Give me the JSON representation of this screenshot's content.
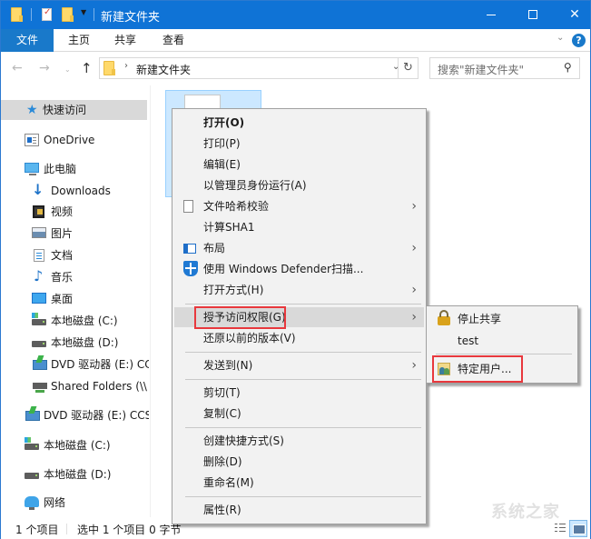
{
  "window": {
    "title": "新建文件夹",
    "controls": {
      "minimize": "minimize",
      "maximize": "maximize",
      "close": "✕"
    }
  },
  "ribbon": {
    "tabs": [
      {
        "label": "文件",
        "active": true
      },
      {
        "label": "主页"
      },
      {
        "label": "共享"
      },
      {
        "label": "查看"
      }
    ],
    "expand_glyph": "⌄",
    "help_glyph": "?"
  },
  "navigation": {
    "back_glyph": "←",
    "forward_glyph": "→",
    "recent_glyph": "⌄",
    "up_glyph": "↑",
    "address_chevron": "›",
    "address_path": "新建文件夹",
    "address_dropdown": "⌄",
    "refresh_glyph": "↻",
    "search_placeholder": "搜索\"新建文件夹\"",
    "search_glyph": "⚲"
  },
  "sidebar": {
    "items": [
      {
        "label": "快速访问",
        "icon": "star-icon",
        "selected": true
      },
      {
        "label": "OneDrive",
        "icon": "onedrive-icon"
      },
      {
        "label": "此电脑",
        "icon": "this-pc-icon"
      },
      {
        "label": "Downloads",
        "icon": "downloads-icon"
      },
      {
        "label": "视频",
        "icon": "videos-icon"
      },
      {
        "label": "图片",
        "icon": "pictures-icon"
      },
      {
        "label": "文档",
        "icon": "documents-icon"
      },
      {
        "label": "音乐",
        "icon": "music-icon"
      },
      {
        "label": "桌面",
        "icon": "desktop-icon"
      },
      {
        "label": "本地磁盘 (C:)",
        "icon": "drive-c-icon"
      },
      {
        "label": "本地磁盘 (D:)",
        "icon": "drive-icon"
      },
      {
        "label": "DVD 驱动器 (E:) CC",
        "icon": "dvd-drive-icon"
      },
      {
        "label": "Shared Folders (\\\\",
        "icon": "network-drive-icon"
      },
      {
        "label": "DVD 驱动器 (E:) CCS",
        "icon": "dvd-drive-icon"
      },
      {
        "label": "本地磁盘 (C:)",
        "icon": "drive-c-icon"
      },
      {
        "label": "本地磁盘 (D:)",
        "icon": "drive-icon"
      },
      {
        "label": "网络",
        "icon": "network-icon"
      }
    ]
  },
  "context_menu": {
    "items": [
      {
        "label": "打开(O)",
        "bold": true
      },
      {
        "label": "打印(P)"
      },
      {
        "label": "编辑(E)"
      },
      {
        "label": "以管理员身份运行(A)"
      },
      {
        "label": "文件哈希校验",
        "icon": "page-icon",
        "submenu": true
      },
      {
        "label": "计算SHA1"
      },
      {
        "label": "布局",
        "icon": "layout-icon",
        "submenu": true
      },
      {
        "label": "使用 Windows Defender扫描...",
        "icon": "defender-shield-icon"
      },
      {
        "label": "打开方式(H)",
        "submenu": true
      },
      {
        "label": "授予访问权限(G)",
        "submenu": true,
        "highlighted": true
      },
      {
        "label": "还原以前的版本(V)"
      },
      {
        "label": "发送到(N)",
        "submenu": true
      },
      {
        "label": "剪切(T)"
      },
      {
        "label": "复制(C)"
      },
      {
        "label": "创建快捷方式(S)"
      },
      {
        "label": "删除(D)"
      },
      {
        "label": "重命名(M)"
      },
      {
        "label": "属性(R)"
      }
    ],
    "submenu_arrow": "›"
  },
  "share_submenu": {
    "items": [
      {
        "label": "停止共享",
        "icon": "lock-icon"
      },
      {
        "label": "test"
      },
      {
        "label": "特定用户...",
        "icon": "users-icon",
        "highlighted": true
      }
    ]
  },
  "statusbar": {
    "item_count": "1 个项目",
    "selection": "选中 1 个项目  0 字节"
  },
  "watermark": "系统之家",
  "colors": {
    "titlebar": "#0f73d6",
    "file_tab": "#1979ca",
    "selection": "#cce8ff",
    "highlight_border": "#e8383d",
    "menu_bg": "#f2f2f2"
  }
}
